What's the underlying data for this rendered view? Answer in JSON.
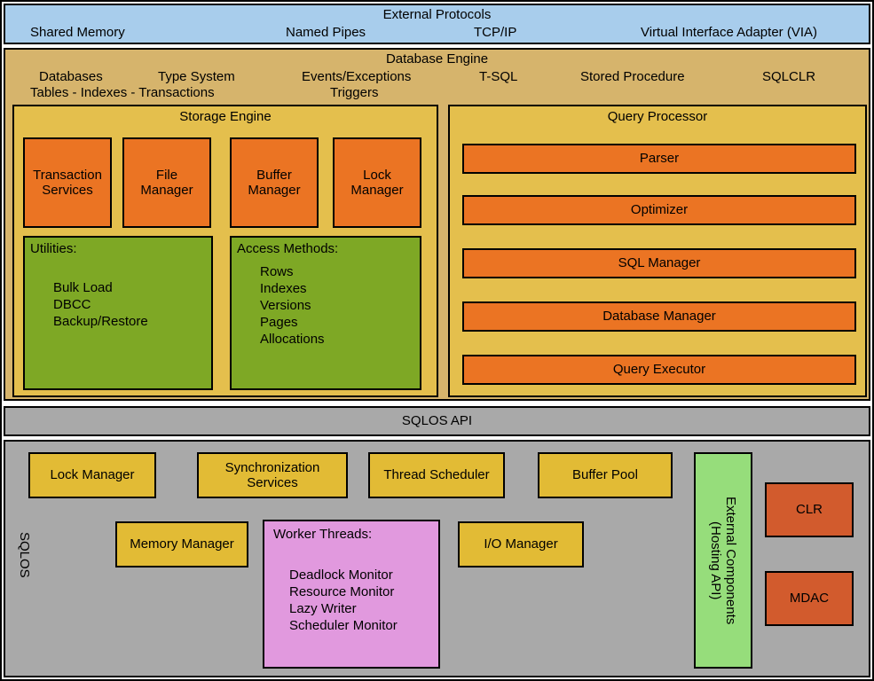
{
  "external": {
    "title": "External Protocols",
    "items": [
      "Shared Memory",
      "Named Pipes",
      "TCP/IP",
      "Virtual Interface Adapter (VIA)"
    ]
  },
  "engine": {
    "title": "Database Engine",
    "row1": [
      "Databases",
      "Type System",
      "Events/Exceptions",
      "T-SQL",
      "Stored Procedure",
      "SQLCLR"
    ],
    "row2": [
      "Tables - Indexes - Transactions",
      "Triggers"
    ]
  },
  "storage": {
    "title": "Storage Engine",
    "managers": [
      "Transaction\nServices",
      "File\nManager",
      "Buffer\nManager",
      "Lock\nManager"
    ],
    "utilities": {
      "title": "Utilities:",
      "items": [
        "Bulk Load",
        "DBCC",
        "Backup/Restore"
      ]
    },
    "access": {
      "title": "Access Methods:",
      "items": [
        "Rows",
        "Indexes",
        "Versions",
        "Pages",
        "Allocations"
      ]
    }
  },
  "query": {
    "title": "Query Processor",
    "items": [
      "Parser",
      "Optimizer",
      "SQL Manager",
      "Database Manager",
      "Query Executor"
    ]
  },
  "sqlos_api": "SQLOS API",
  "sqlos": {
    "label": "SQLOS",
    "row1": [
      "Lock Manager",
      "Synchronization\nServices",
      "Thread Scheduler",
      "Buffer Pool"
    ],
    "memmgr": "Memory Manager",
    "worker": {
      "title": "Worker Threads:",
      "items": [
        "Deadlock Monitor",
        "Resource Monitor",
        "Lazy Writer",
        "Scheduler Monitor"
      ]
    },
    "iomgr": "I/O Manager",
    "extcomp": "External Components\n(Hosting API)",
    "clr": "CLR",
    "mdac": "MDAC"
  }
}
